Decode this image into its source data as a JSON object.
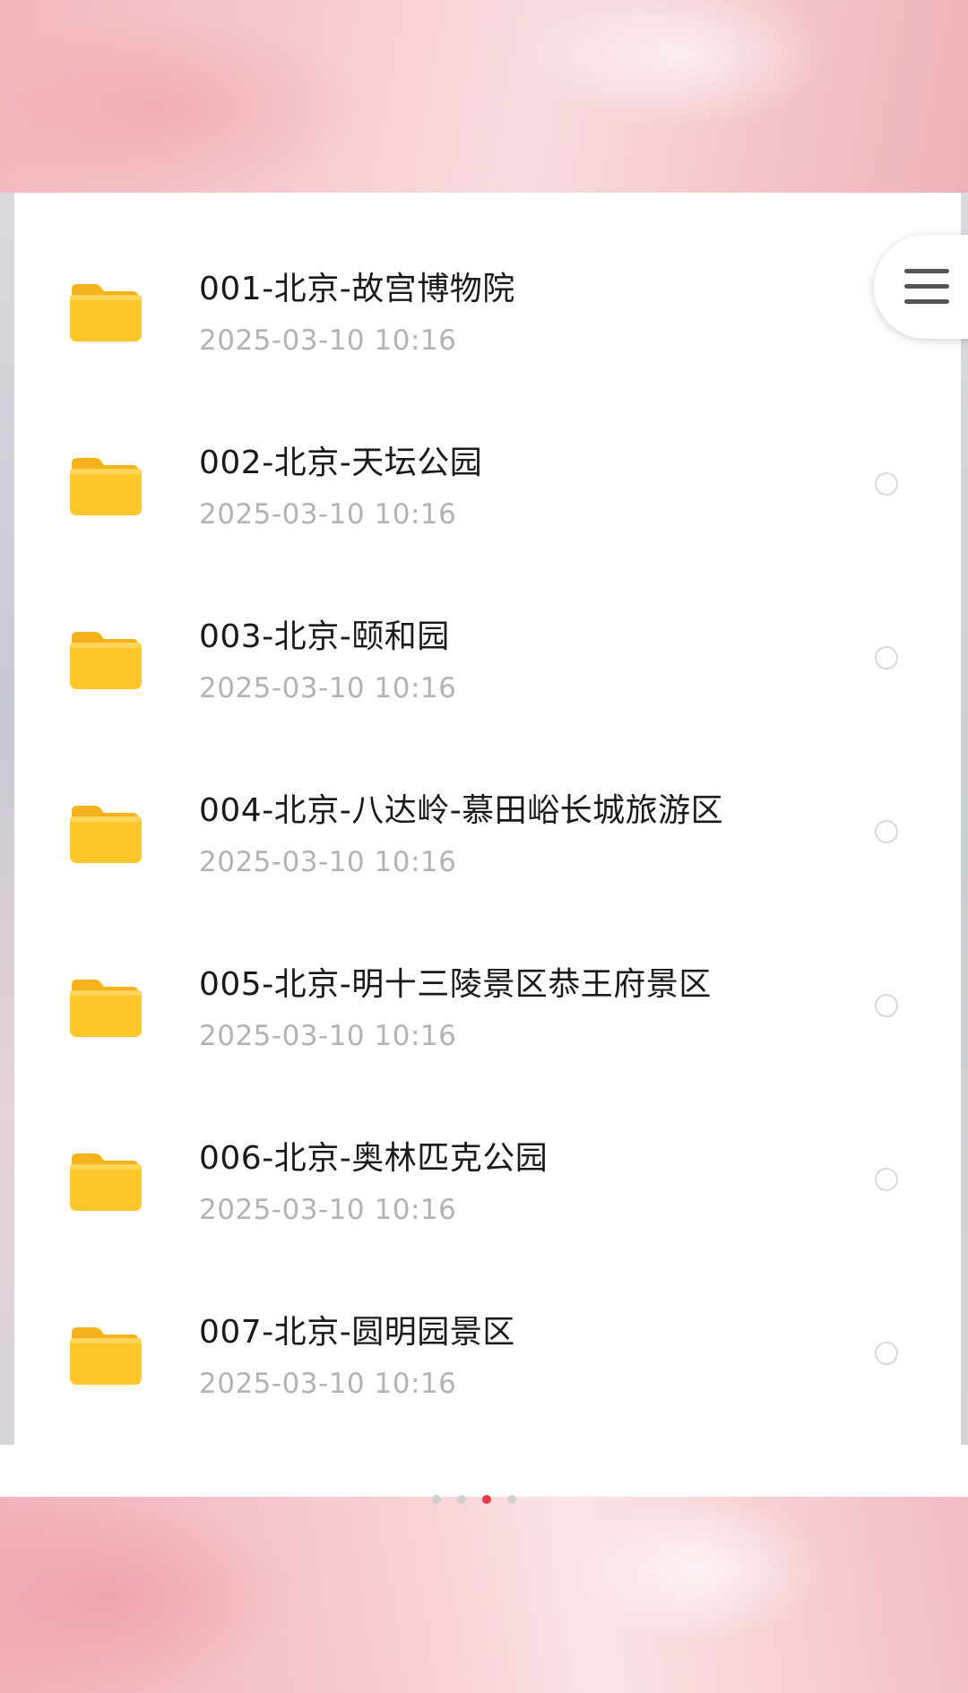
{
  "colors": {
    "folder": "#ffc72b",
    "title_text": "#1a1a1a",
    "date_text": "#b3b3b3",
    "active_dot": "#e83b4a"
  },
  "menu_button": {
    "icon": "hamburger-icon"
  },
  "files": [
    {
      "name": "001-北京-故宫博物院",
      "date": "2025-03-10  10:16",
      "icon": "folder-icon"
    },
    {
      "name": "002-北京-天坛公园",
      "date": "2025-03-10  10:16",
      "icon": "folder-icon"
    },
    {
      "name": "003-北京-颐和园",
      "date": "2025-03-10  10:16",
      "icon": "folder-icon"
    },
    {
      "name": "004-北京-八达岭-慕田峪长城旅游区",
      "date": "2025-03-10  10:16",
      "icon": "folder-icon"
    },
    {
      "name": "005-北京-明十三陵景区恭王府景区",
      "date": "2025-03-10  10:16",
      "icon": "folder-icon"
    },
    {
      "name": "006-北京-奥林匹克公园",
      "date": "2025-03-10  10:16",
      "icon": "folder-icon"
    },
    {
      "name": "007-北京-圆明园景区",
      "date": "2025-03-10  10:16",
      "icon": "folder-icon"
    }
  ],
  "pager": {
    "total": 4,
    "active_index": 2
  }
}
